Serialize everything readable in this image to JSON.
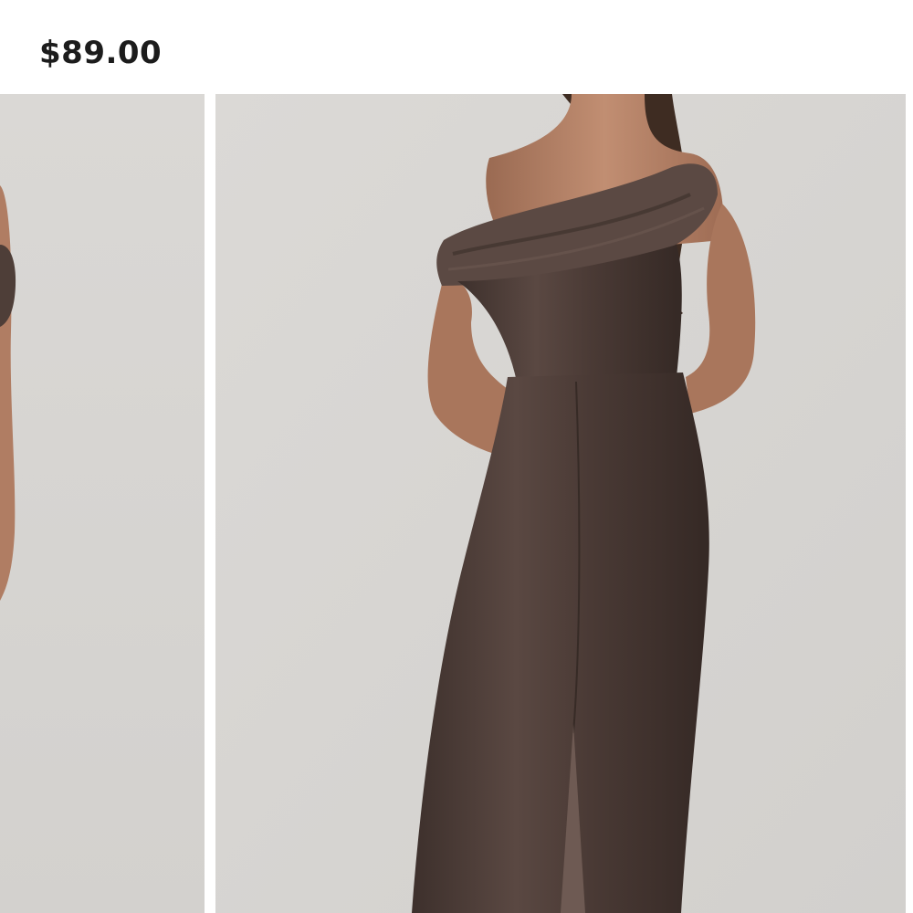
{
  "product": {
    "price": "$89.00"
  },
  "gallery": {
    "images": [
      {
        "icon": "product-photo-side-view"
      },
      {
        "icon": "product-photo-back-view"
      }
    ]
  },
  "colors": {
    "background": "#d8d6d3",
    "dress": "#4a3b36",
    "price_text": "#1c1c1c"
  }
}
